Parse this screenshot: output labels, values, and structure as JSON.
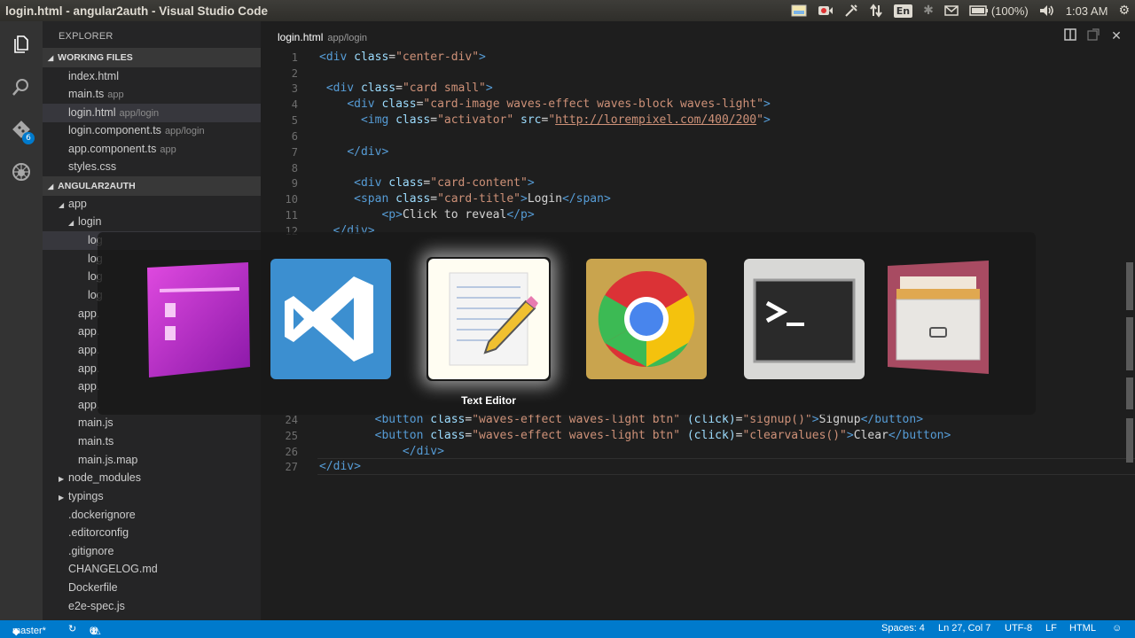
{
  "window": {
    "title": "login.html - angular2auth - Visual Studio Code"
  },
  "panel": {
    "keyboard": "En",
    "battery": "(100%)",
    "clock": "1:03 AM"
  },
  "activity": {
    "git_badge": "6"
  },
  "explorer": {
    "title": "EXPLORER",
    "working_files_header": "WORKING FILES",
    "working_files": [
      {
        "name": "index.html",
        "path": ""
      },
      {
        "name": "main.ts",
        "path": "app"
      },
      {
        "name": "login.html",
        "path": "app/login"
      },
      {
        "name": "login.component.ts",
        "path": "app/login"
      },
      {
        "name": "app.component.ts",
        "path": "app"
      },
      {
        "name": "styles.css",
        "path": ""
      }
    ],
    "project_header": "ANGULAR2AUTH",
    "tree": {
      "app": "app",
      "login": "login",
      "login_children": [
        "log",
        "log",
        "log",
        "log"
      ],
      "app_files": [
        "app.",
        "app.",
        "app.",
        "app.",
        "app.",
        "app."
      ],
      "main_js": "main.js",
      "main_ts": "main.ts",
      "main_js_map": "main.js.map",
      "node_modules": "node_modules",
      "typings": "typings",
      "root_files": [
        ".dockerignore",
        ".editorconfig",
        ".gitignore",
        "CHANGELOG.md",
        "Dockerfile",
        "e2e-spec.js"
      ]
    }
  },
  "editor": {
    "tab": {
      "file": "login.html",
      "path": "app/login"
    },
    "lines": [
      {
        "n": "1",
        "src": "<div class=\"center-div\">"
      },
      {
        "n": "2",
        "src": ""
      },
      {
        "n": "3",
        "src": " <div class=\"card small\">"
      },
      {
        "n": "4",
        "src": "    <div class=\"card-image waves-effect waves-block waves-light\">"
      },
      {
        "n": "5",
        "src": "      <img class=\"activator\" src=\"http://lorempixel.com/400/200\">"
      },
      {
        "n": "6",
        "src": ""
      },
      {
        "n": "7",
        "src": "    </div>"
      },
      {
        "n": "8",
        "src": ""
      },
      {
        "n": "9",
        "src": "     <div class=\"card-content\">"
      },
      {
        "n": "10",
        "src": "     <span class=\"card-title\">Login</span>"
      },
      {
        "n": "11",
        "src": "         <p>Click to reveal</p>"
      },
      {
        "n": "12",
        "src": "  </div>"
      },
      {
        "n": "24",
        "src": "        <button class=\"waves-effect waves-light btn\" (click)=\"signup()\">Signup</button>"
      },
      {
        "n": "25",
        "src": "        <button class=\"waves-effect waves-light btn\" (click)=\"clearvalues()\">Clear</button>"
      },
      {
        "n": "26",
        "src": "            </div>"
      },
      {
        "n": "27",
        "src": "</div>"
      }
    ]
  },
  "switcher": {
    "apps": [
      {
        "name": "visual-studio-code-purple",
        "icon": "vs-purple-icon"
      },
      {
        "name": "visual-studio-code",
        "icon": "vscode-icon"
      },
      {
        "name": "text-editor",
        "icon": "text-editor-icon"
      },
      {
        "name": "chrome",
        "icon": "chrome-icon"
      },
      {
        "name": "terminal",
        "icon": "terminal-icon"
      },
      {
        "name": "file-cabinet",
        "icon": "file-cabinet-icon"
      }
    ],
    "selected_label": "Text Editor"
  },
  "statusbar": {
    "branch": "master*",
    "errors": "0",
    "warnings": "0",
    "indent": "Spaces: 4",
    "position": "Ln 27, Col 7",
    "encoding": "UTF-8",
    "eol": "LF",
    "language": "HTML"
  },
  "colors": {
    "accent": "#007acc",
    "tag": "#569cd6",
    "attribute": "#9cdcfe",
    "string": "#ce9178"
  }
}
